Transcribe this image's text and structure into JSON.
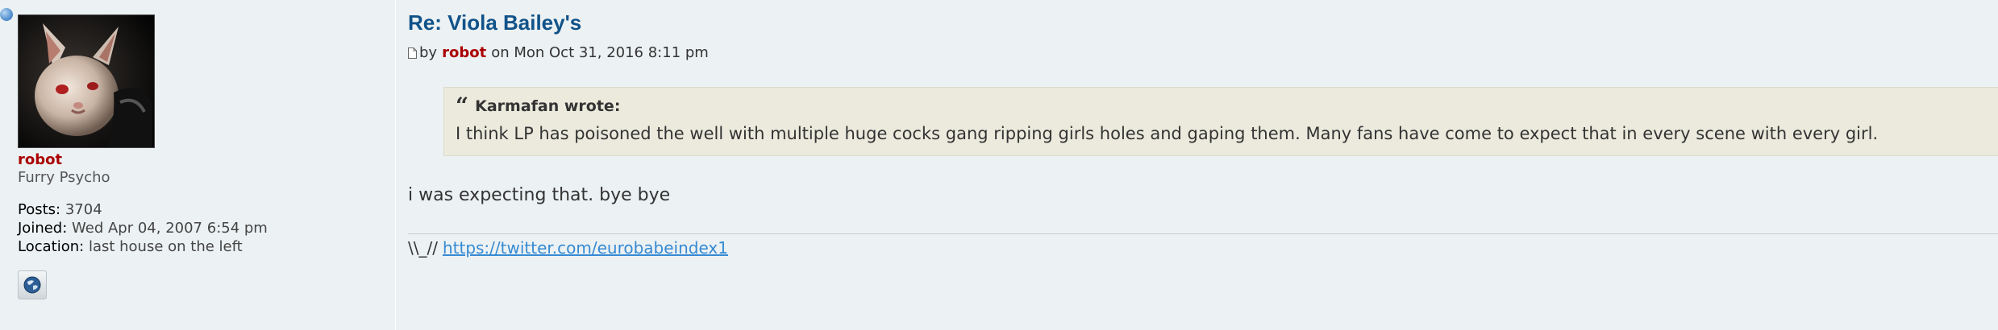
{
  "post": {
    "title": "Re: Viola Bailey's",
    "by_label": "by",
    "author": "robot",
    "date_text": "on Mon Oct 31, 2016 8:11 pm"
  },
  "profile": {
    "username": "robot",
    "rank": "Furry Psycho",
    "posts_label": "Posts:",
    "posts_value": "3704",
    "joined_label": "Joined:",
    "joined_value": "Wed Apr 04, 2007 6:54 pm",
    "location_label": "Location:",
    "location_value": "last house on the left"
  },
  "quote": {
    "cite": "Karmafan wrote:",
    "text": "I think LP has poisoned the well with multiple huge cocks gang ripping girls holes and gaping them. Many fans have come to expect that in every scene with every girl."
  },
  "reply": {
    "text": "i was expecting that. bye bye"
  },
  "signature": {
    "prefix": "\\\\_//",
    "link_text": "https://twitter.com/eurobabeindex1"
  },
  "colors": {
    "background": "#ECF1F3",
    "title": "#105289",
    "username": "#AA0000",
    "quote_bg": "#EBEADD",
    "link": "#368AD2"
  },
  "icons": {
    "online": "online-status-icon",
    "post": "post-icon",
    "quote": "quote-icon",
    "website": "globe-icon"
  }
}
